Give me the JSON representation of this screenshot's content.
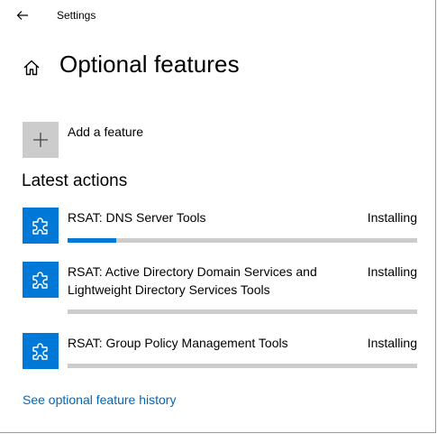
{
  "titlebar": {
    "back_icon": "back-arrow-icon",
    "app_title": "Settings"
  },
  "header": {
    "home_icon": "home-icon",
    "page_title": "Optional features"
  },
  "add_feature": {
    "icon": "plus-icon",
    "label": "Add a feature"
  },
  "latest_actions": {
    "title": "Latest actions",
    "items": [
      {
        "name": "RSAT: DNS Server Tools",
        "status": "Installing",
        "progress": 0.14,
        "icon": "puzzle-piece-icon"
      },
      {
        "name": "RSAT: Active Directory Domain Services and Lightweight Directory Services Tools",
        "status": "Installing",
        "progress": 0,
        "icon": "puzzle-piece-icon"
      },
      {
        "name": "RSAT: Group Policy Management Tools",
        "status": "Installing",
        "progress": 0,
        "icon": "puzzle-piece-icon"
      }
    ]
  },
  "history_link": "See optional feature history",
  "colors": {
    "accent": "#0078d7",
    "tile_gray": "#cccccc",
    "track": "#cccccc",
    "link": "#0067b8"
  }
}
